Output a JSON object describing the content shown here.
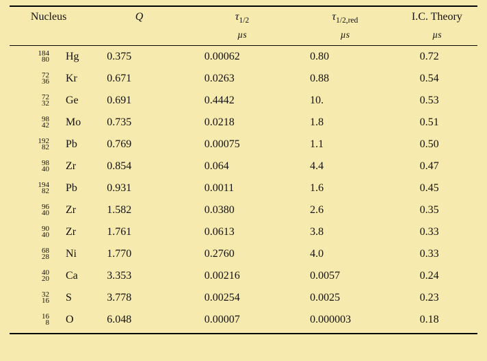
{
  "headers": {
    "nucleus": "Nucleus",
    "Q": "Q",
    "tau12": "τ",
    "tau12_sub": "1/2",
    "tau12red": "τ",
    "tau12red_sub": "1/2,red",
    "ictheory": "I.C. Theory",
    "mus": "µs"
  },
  "rows": [
    {
      "A": "184",
      "Z": "80",
      "el": "Hg",
      "Q": "0.375",
      "t12": "0.00062",
      "t12red": "0.80",
      "ict": "0.72"
    },
    {
      "A": "72",
      "Z": "36",
      "el": "Kr",
      "Q": "0.671",
      "t12": "0.0263",
      "t12red": "0.88",
      "ict": "0.54"
    },
    {
      "A": "72",
      "Z": "32",
      "el": "Ge",
      "Q": "0.691",
      "t12": "0.4442",
      "t12red": "10.",
      "ict": "0.53"
    },
    {
      "A": "98",
      "Z": "42",
      "el": "Mo",
      "Q": "0.735",
      "t12": "0.0218",
      "t12red": "1.8",
      "ict": "0.51"
    },
    {
      "A": "192",
      "Z": "82",
      "el": "Pb",
      "Q": "0.769",
      "t12": "0.00075",
      "t12red": "1.1",
      "ict": "0.50"
    },
    {
      "A": "98",
      "Z": "40",
      "el": "Zr",
      "Q": "0.854",
      "t12": "0.064",
      "t12red": "4.4",
      "ict": "0.47"
    },
    {
      "A": "194",
      "Z": "82",
      "el": "Pb",
      "Q": "0.931",
      "t12": "0.0011",
      "t12red": "1.6",
      "ict": "0.45"
    },
    {
      "A": "96",
      "Z": "40",
      "el": "Zr",
      "Q": "1.582",
      "t12": "0.0380",
      "t12red": "2.6",
      "ict": "0.35"
    },
    {
      "A": "90",
      "Z": "40",
      "el": "Zr",
      "Q": "1.761",
      "t12": "0.0613",
      "t12red": "3.8",
      "ict": "0.33"
    },
    {
      "A": "68",
      "Z": "28",
      "el": "Ni",
      "Q": "1.770",
      "t12": "0.2760",
      "t12red": "4.0",
      "ict": "0.33"
    },
    {
      "A": "40",
      "Z": "20",
      "el": "Ca",
      "Q": "3.353",
      "t12": "0.00216",
      "t12red": "0.0057",
      "ict": "0.24"
    },
    {
      "A": "32",
      "Z": "16",
      "el": "S",
      "Q": "3.778",
      "t12": "0.00254",
      "t12red": "0.0025",
      "ict": "0.23"
    },
    {
      "A": "16",
      "Z": "8",
      "el": "O",
      "Q": "6.048",
      "t12": "0.00007",
      "t12red": "0.000003",
      "ict": "0.18"
    }
  ]
}
